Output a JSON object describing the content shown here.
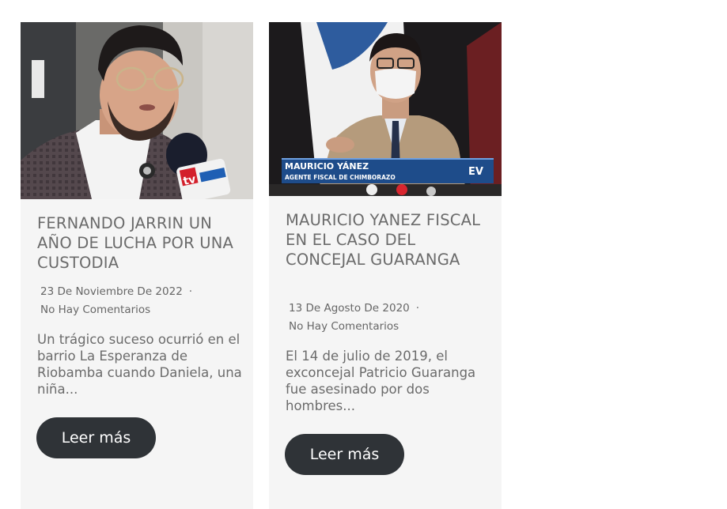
{
  "posts": [
    {
      "image_overlay": {
        "logo": "tv"
      },
      "title": "FERNANDO JARRIN UN AÑO DE LUCHA POR UNA CUSTODIA",
      "date": "23 De Noviembre De 2022",
      "separator": "·",
      "comments": "No Hay Comentarios",
      "excerpt": "Un trágico suceso ocurrió en el barrio La Esperanza de Riobamba cuando Daniela, una niña...",
      "button": "Leer más"
    },
    {
      "image_overlay": {
        "name": "MAURICIO YÁNEZ",
        "role": "AGENTE FISCAL DE CHIMBORAZO",
        "logo": "EV"
      },
      "title": "MAURICIO YANEZ FISCAL EN EL CASO DEL CONCEJAL GUARANGA",
      "date": "13 De Agosto De 2020",
      "separator": "·",
      "comments": "No Hay Comentarios",
      "excerpt": "El 14 de julio de 2019, el exconcejal Patricio Guaranga fue asesinado por dos hombres...",
      "button": "Leer más"
    }
  ]
}
